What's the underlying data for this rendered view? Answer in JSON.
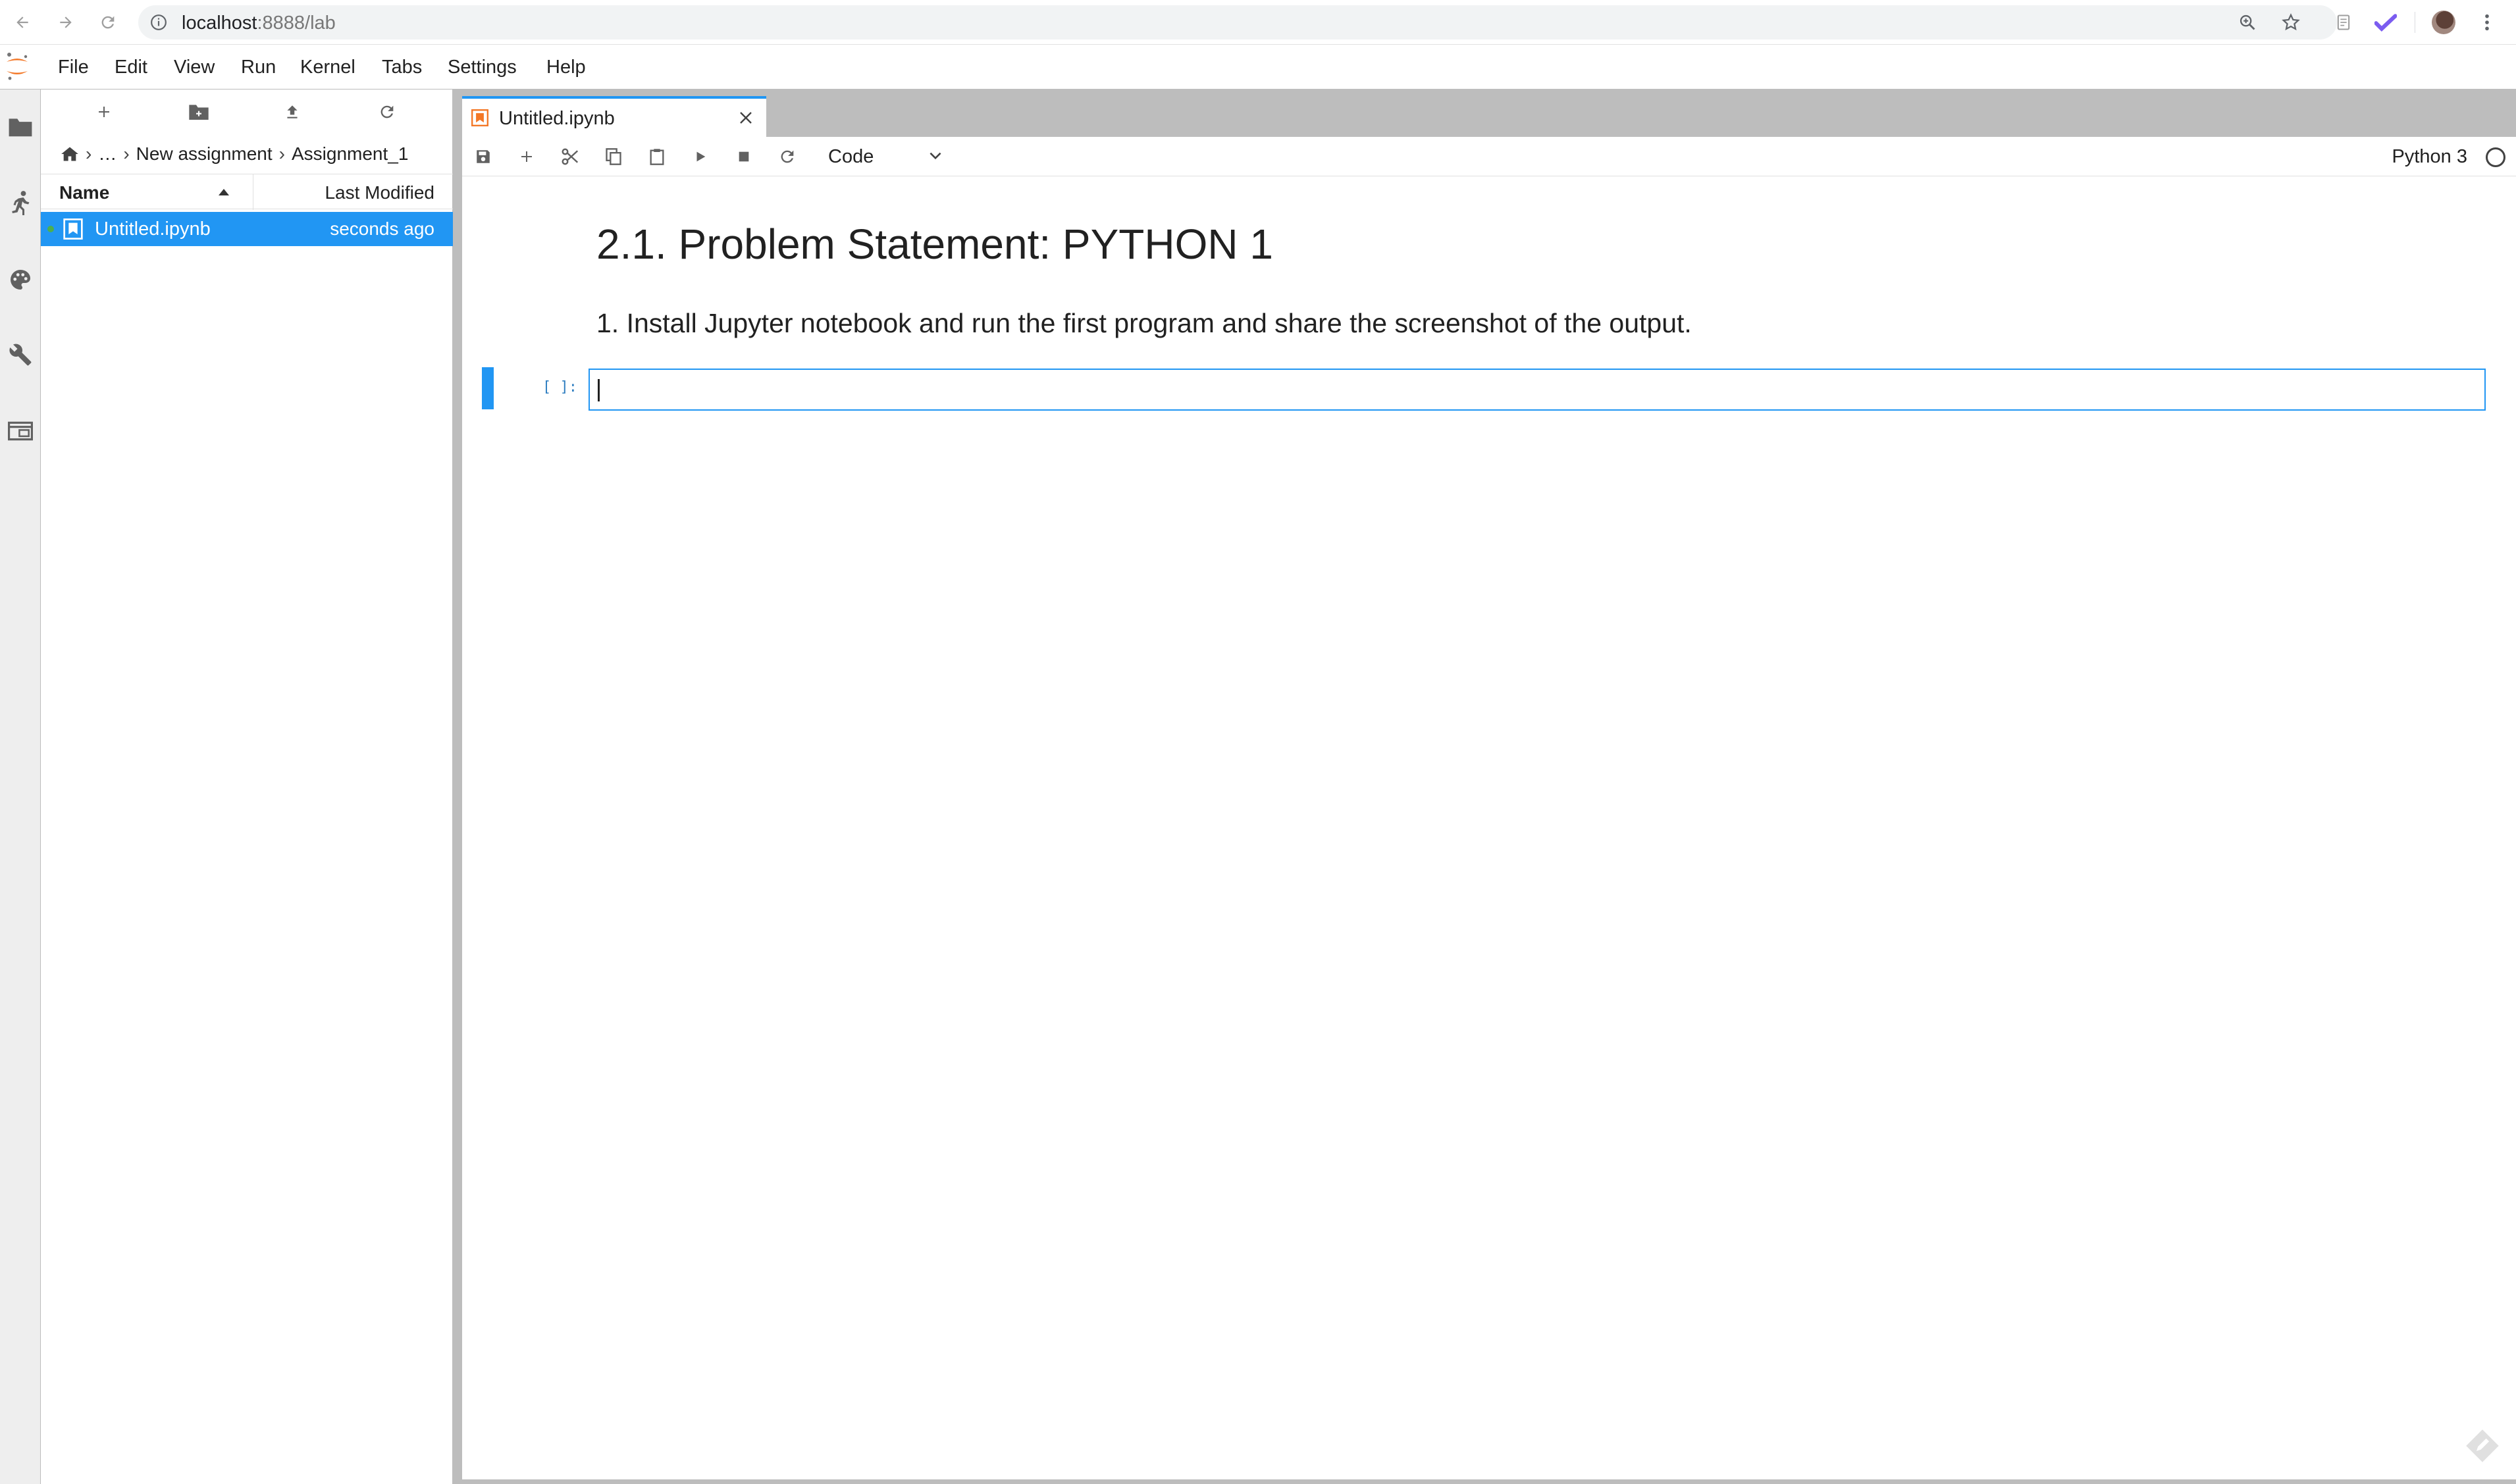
{
  "browser": {
    "url_host": "localhost",
    "url_rest": ":8888/lab"
  },
  "menubar": {
    "items": [
      "File",
      "Edit",
      "View",
      "Run",
      "Kernel",
      "Tabs",
      "Settings",
      "Help"
    ]
  },
  "filebrowser": {
    "breadcrumb": [
      "…",
      "New assignment",
      "Assignment_1"
    ],
    "columns": {
      "name": "Name",
      "modified": "Last Modified"
    },
    "files": [
      {
        "name": "Untitled.ipynb",
        "modified": "seconds ago",
        "selected": true,
        "running": true
      }
    ]
  },
  "notebook": {
    "tab_title": "Untitled.ipynb",
    "cell_type": "Code",
    "kernel": "Python 3",
    "markdown_heading": "2.1. Problem Statement: PYTHON 1",
    "markdown_text": "1. Install Jupyter notebook and run the first program and share the screenshot of the output.",
    "code_prompt": "[ ]:",
    "code_value": ""
  },
  "colors": {
    "accent": "#2196f3",
    "jupyter_orange": "#f37726",
    "running_dot": "#4caf50"
  },
  "icons": {
    "activity": [
      "folder-icon",
      "running-icon",
      "palette-icon",
      "wrench-icon",
      "tabs-icon"
    ],
    "toolbar": [
      "save-icon",
      "add-icon",
      "cut-icon",
      "copy-icon",
      "paste-icon",
      "run-icon",
      "stop-icon",
      "restart-icon"
    ]
  }
}
